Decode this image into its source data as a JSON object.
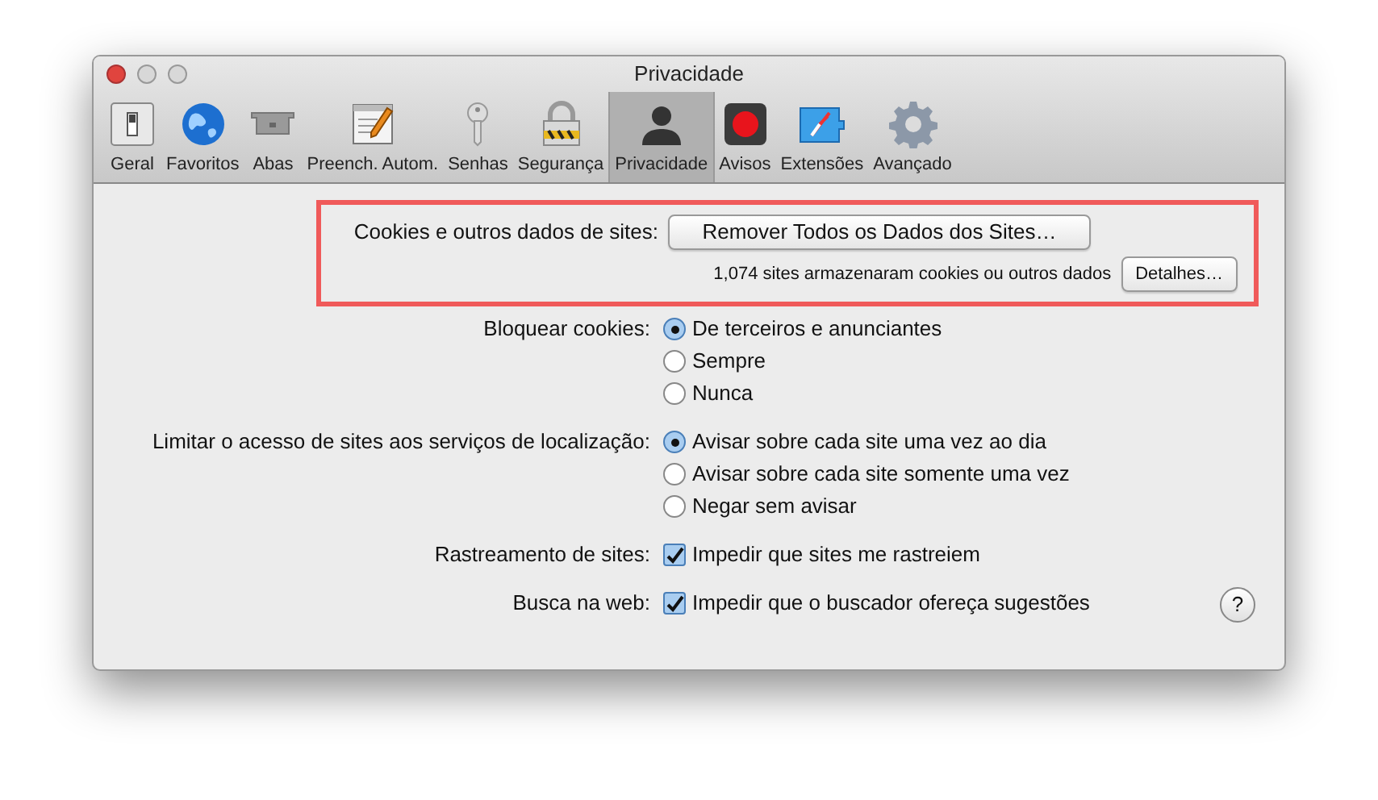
{
  "window": {
    "title": "Privacidade"
  },
  "toolbar": [
    {
      "label": "Geral",
      "kind": "switch",
      "selected": false
    },
    {
      "label": "Favoritos",
      "kind": "globe",
      "selected": false
    },
    {
      "label": "Abas",
      "kind": "tray",
      "selected": false
    },
    {
      "label": "Preench. Autom.",
      "kind": "pencil",
      "selected": false
    },
    {
      "label": "Senhas",
      "kind": "key",
      "selected": false
    },
    {
      "label": "Segurança",
      "kind": "lock",
      "selected": false
    },
    {
      "label": "Privacidade",
      "kind": "person",
      "selected": true
    },
    {
      "label": "Avisos",
      "kind": "record",
      "selected": false
    },
    {
      "label": "Extensões",
      "kind": "puzzle",
      "selected": false
    },
    {
      "label": "Avançado",
      "kind": "gear",
      "selected": false
    }
  ],
  "cookies": {
    "highlighted": true,
    "label": "Cookies e outros dados de sites:",
    "button": "Remover Todos os Dados dos Sites…",
    "info": "1,074 sites armazenaram cookies ou outros dados",
    "details_button": "Detalhes…"
  },
  "settings": [
    {
      "label": "Bloquear cookies:",
      "kind": "radio",
      "options": [
        {
          "label": "De terceiros e anunciantes",
          "selected": true
        },
        {
          "label": "Sempre",
          "selected": false
        },
        {
          "label": "Nunca",
          "selected": false
        }
      ]
    },
    {
      "label": "Limitar o acesso de sites aos serviços de localização:",
      "kind": "radio",
      "options": [
        {
          "label": "Avisar sobre cada site uma vez ao dia",
          "selected": true
        },
        {
          "label": "Avisar sobre cada site somente uma vez",
          "selected": false
        },
        {
          "label": "Negar sem avisar",
          "selected": false
        }
      ]
    },
    {
      "label": "Rastreamento de sites:",
      "kind": "checkbox",
      "options": [
        {
          "label": "Impedir que sites me rastreiem",
          "checked": true
        }
      ]
    },
    {
      "label": "Busca na web:",
      "kind": "checkbox",
      "options": [
        {
          "label": "Impedir que o buscador ofereça sugestões",
          "checked": true
        }
      ]
    }
  ],
  "help_button": "?"
}
